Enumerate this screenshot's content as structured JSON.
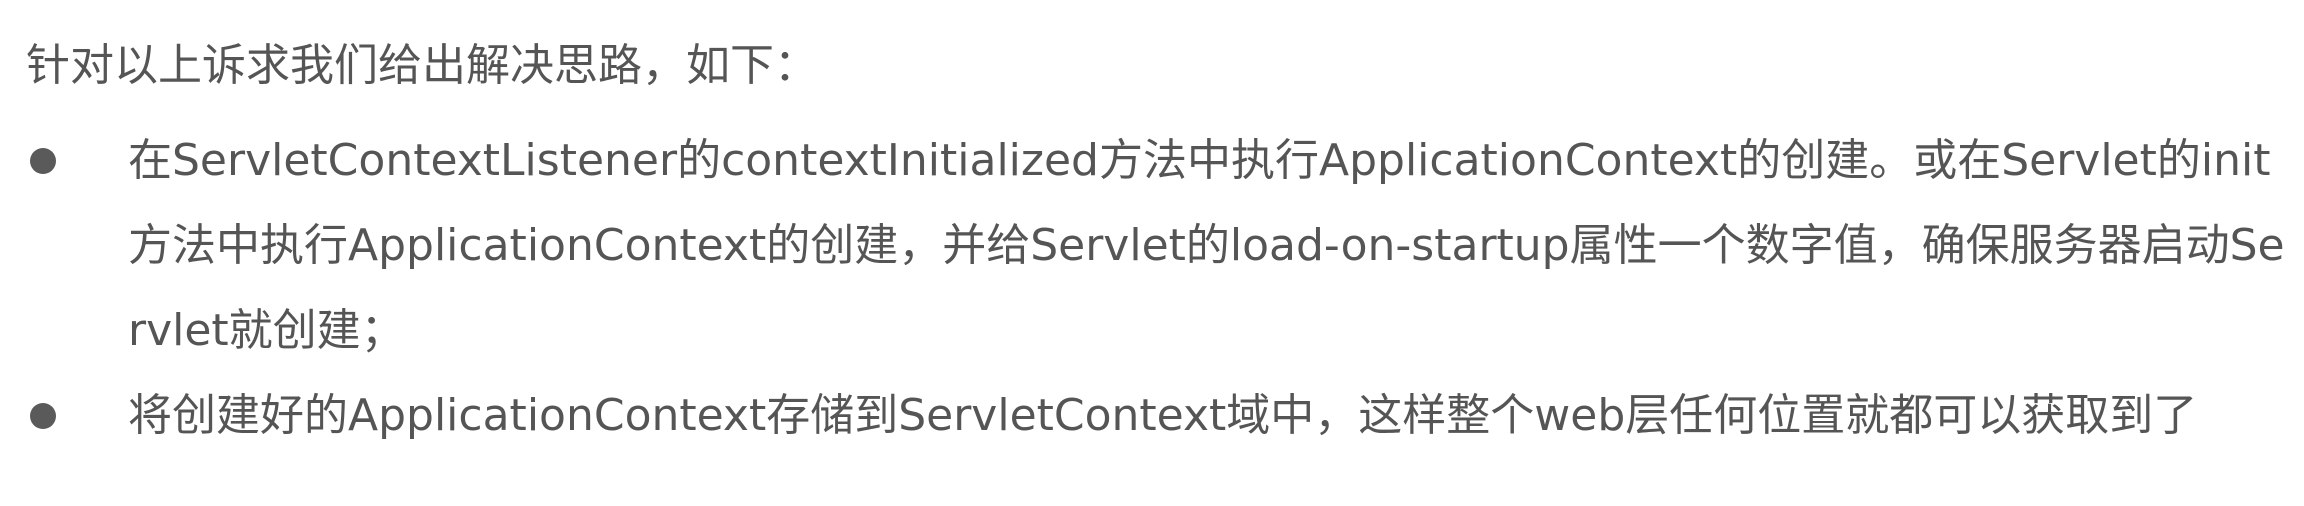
{
  "document": {
    "intro": "针对以上诉求我们给出解决思路，如下：",
    "bullets": [
      {
        "text": "在ServletContextListener的contextInitialized方法中执行ApplicationContext的创建。或在Servlet的init方法中执行ApplicationContext的创建，并给Servlet的load-on-startup属性一个数字值，确保服务器启动Servlet就创建；"
      },
      {
        "text": "将创建好的ApplicationContext存储到ServletContext域中，这样整个web层任何位置就都可以获取到了"
      }
    ]
  }
}
